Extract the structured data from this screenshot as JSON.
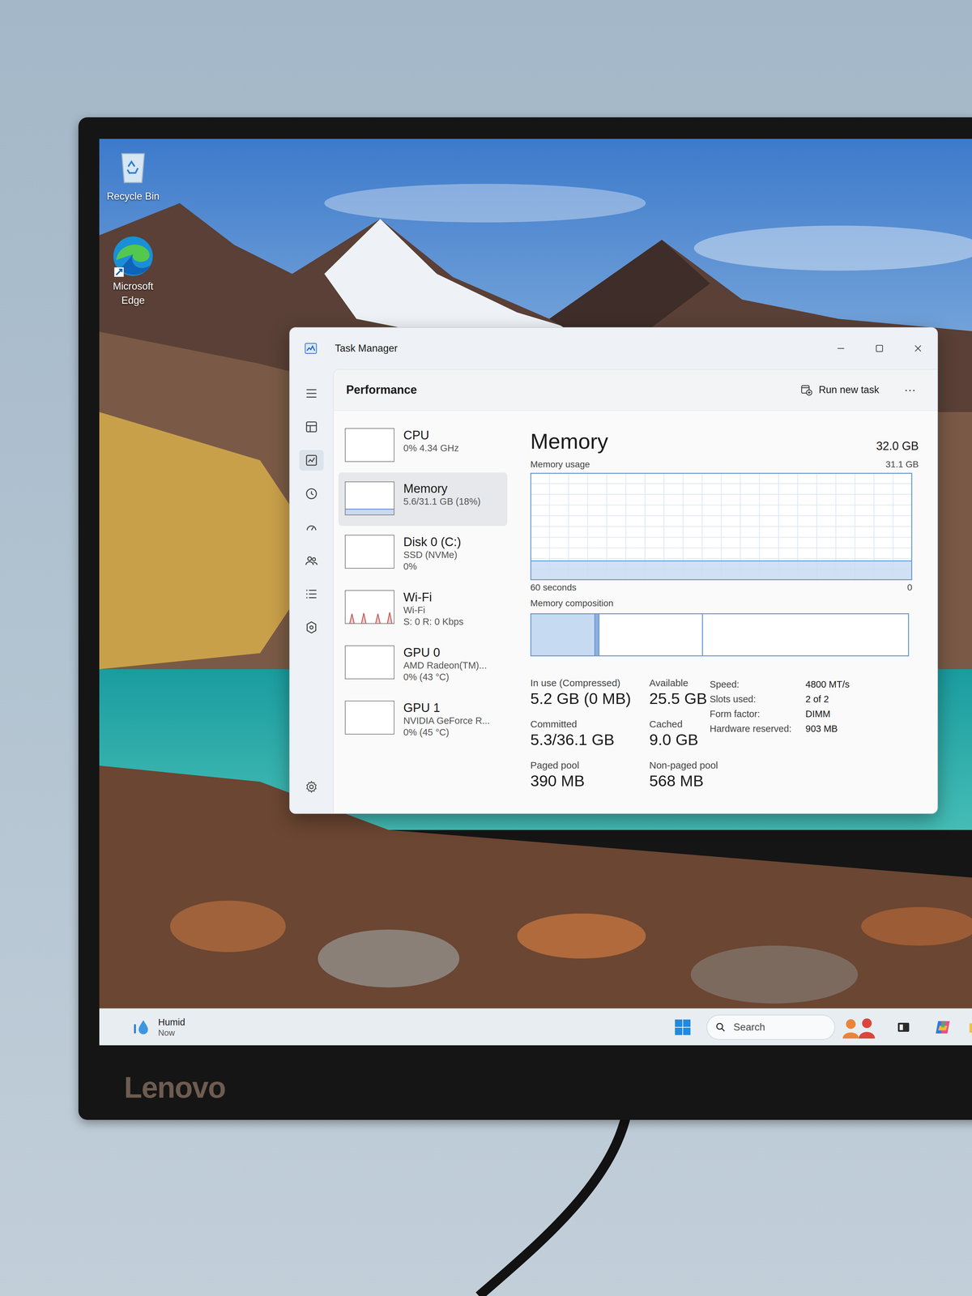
{
  "monitor": {
    "brand": "Lenovo"
  },
  "desktop": {
    "icons": [
      {
        "label": "Recycle Bin"
      },
      {
        "label": "Microsoft Edge"
      }
    ]
  },
  "window": {
    "title": "Task Manager"
  },
  "nav": {
    "items": [
      {
        "selected": false
      },
      {
        "selected": false
      },
      {
        "selected": true
      },
      {
        "selected": false
      },
      {
        "selected": false
      },
      {
        "selected": false
      },
      {
        "selected": false
      },
      {
        "selected": false
      }
    ]
  },
  "header": {
    "title": "Performance",
    "run_button": "Run new task",
    "more": "···"
  },
  "devices": [
    {
      "name": "CPU",
      "lines": [
        "0% 4.34 GHz"
      ],
      "selected": false,
      "color": "#2f80d1",
      "graph": [
        0,
        0,
        0,
        0,
        0,
        0,
        0,
        0,
        0,
        0,
        0,
        0,
        0,
        0,
        0,
        0,
        0,
        0,
        0,
        0,
        0,
        0
      ]
    },
    {
      "name": "Memory",
      "lines": [
        "5.6/31.1 GB (18%)"
      ],
      "selected": true,
      "color": "#5b82cf",
      "graph": [
        18,
        18,
        18,
        18,
        18,
        18,
        18,
        18,
        18,
        18,
        18,
        18,
        18,
        18,
        18,
        18,
        18,
        18,
        18,
        18,
        18,
        18
      ]
    },
    {
      "name": "Disk 0 (C:)",
      "lines": [
        "SSD (NVMe)",
        "0%"
      ],
      "selected": false,
      "color": "#4caf50",
      "graph": [
        0,
        0,
        0,
        0,
        0,
        0,
        0,
        0,
        0,
        0,
        0,
        0,
        0,
        0,
        0,
        0,
        0,
        0,
        0,
        0,
        0,
        0
      ]
    },
    {
      "name": "Wi-Fi",
      "lines": [
        "Wi-Fi",
        "S: 0 R: 0 Kbps"
      ],
      "selected": false,
      "color": "#c0504d",
      "graph": [
        0,
        0,
        0,
        30,
        0,
        0,
        0,
        0,
        32,
        0,
        0,
        0,
        0,
        0,
        30,
        0,
        0,
        0,
        0,
        34,
        0,
        0
      ]
    },
    {
      "name": "GPU 0",
      "lines": [
        "AMD Radeon(TM)...",
        "0% (43 °C)"
      ],
      "selected": false,
      "color": "#2f80d1",
      "graph": [
        0,
        0,
        0,
        0,
        0,
        0,
        0,
        0,
        0,
        0,
        0,
        0,
        0,
        0,
        0,
        0,
        0,
        0,
        0,
        0,
        0,
        0
      ]
    },
    {
      "name": "GPU 1",
      "lines": [
        "NVIDIA GeForce R...",
        "0% (45 °C)"
      ],
      "selected": false,
      "color": "#2f80d1",
      "graph": [
        0,
        0,
        0,
        0,
        0,
        0,
        0,
        0,
        0,
        0,
        0,
        0,
        0,
        0,
        0,
        0,
        0,
        0,
        0,
        0,
        0,
        0
      ]
    }
  ],
  "detail": {
    "title": "Memory",
    "total": "32.0 GB",
    "usage_label": "Memory usage",
    "usage_max": "31.1 GB",
    "usage": {
      "max": 31.1,
      "values": [
        5.6,
        5.6,
        5.6,
        5.6,
        5.6,
        5.6,
        5.6,
        5.6,
        5.6,
        5.6,
        5.6,
        5.6,
        5.6,
        5.6,
        5.6,
        5.6,
        5.6,
        5.6,
        5.6,
        5.6,
        5.6,
        5.6,
        5.6,
        5.6,
        5.6,
        5.6,
        5.6,
        5.6,
        5.6,
        5.6
      ]
    },
    "axis_left": "60 seconds",
    "axis_right": "0",
    "composition_label": "Memory composition",
    "composition": [
      {
        "kind": "in-use",
        "level": 0.17
      },
      {
        "kind": "modified",
        "level": 0.011
      },
      {
        "kind": "standby",
        "level": 0.275
      },
      {
        "kind": "free",
        "level": 0.544
      }
    ],
    "stats": [
      {
        "label": "In use (Compressed)",
        "value": "5.2 GB (0 MB)"
      },
      {
        "label": "Available",
        "value": "25.5 GB"
      },
      {
        "label": "Committed",
        "value": "5.3/36.1 GB"
      },
      {
        "label": "Cached",
        "value": "9.0 GB"
      },
      {
        "label": "Paged pool",
        "value": "390 MB"
      },
      {
        "label": "Non-paged pool",
        "value": "568 MB"
      }
    ],
    "specs": [
      {
        "label": "Speed:",
        "value": "4800 MT/s"
      },
      {
        "label": "Slots used:",
        "value": "2 of 2"
      },
      {
        "label": "Form factor:",
        "value": "DIMM"
      },
      {
        "label": "Hardware reserved:",
        "value": "903 MB"
      }
    ]
  },
  "taskbar": {
    "weather": {
      "title": "Humid",
      "subtitle": "Now"
    },
    "search": {
      "placeholder": "Search"
    }
  }
}
